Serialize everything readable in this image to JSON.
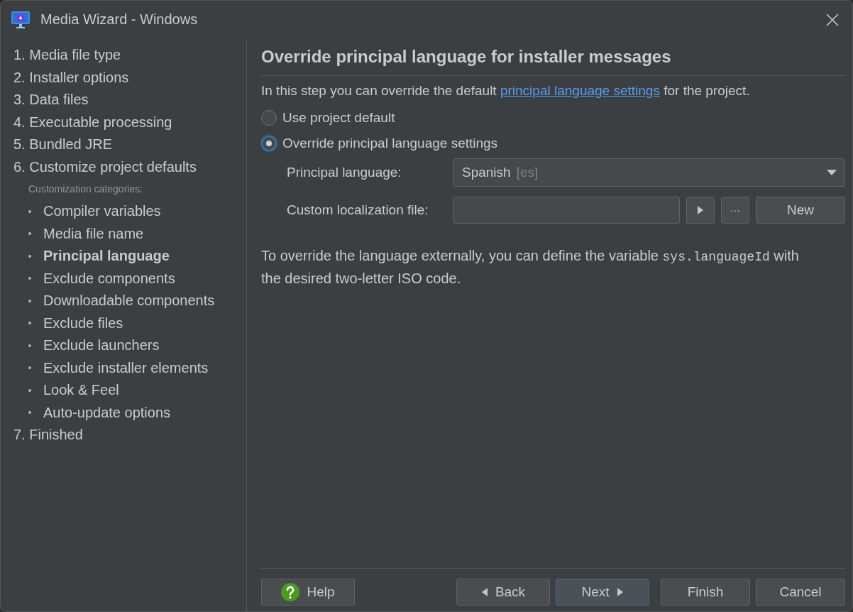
{
  "window": {
    "title": "Media Wizard - Windows"
  },
  "sidebar": {
    "steps": [
      {
        "label": "1. Media file type",
        "selected": false
      },
      {
        "label": "2. Installer options",
        "selected": false
      },
      {
        "label": "3. Data files",
        "selected": false
      },
      {
        "label": "4. Executable processing",
        "selected": false
      },
      {
        "label": "5. Bundled JRE",
        "selected": false
      },
      {
        "label": "6. Customize project defaults",
        "selected": false,
        "caption": "Customization categories:",
        "children": [
          {
            "label": "Compiler variables",
            "selected": false
          },
          {
            "label": "Media file name",
            "selected": false
          },
          {
            "label": "Principal language",
            "selected": true
          },
          {
            "label": "Exclude components",
            "selected": false
          },
          {
            "label": "Downloadable components",
            "selected": false
          },
          {
            "label": "Exclude files",
            "selected": false
          },
          {
            "label": "Exclude launchers",
            "selected": false
          },
          {
            "label": "Exclude installer elements",
            "selected": false
          },
          {
            "label": "Look & Feel",
            "selected": false
          },
          {
            "label": "Auto-update options",
            "selected": false
          }
        ]
      },
      {
        "label": "7. Finished",
        "selected": false
      }
    ]
  },
  "content": {
    "heading": "Override principal language for installer messages",
    "intro": {
      "before": "In this step you can override the default ",
      "link": "principal language settings",
      "after": " for the project."
    },
    "options": [
      {
        "label": "Use project default",
        "selected": false
      },
      {
        "label": "Override principal language settings",
        "selected": true
      }
    ],
    "principal_language": {
      "label": "Principal language:",
      "value": "Spanish",
      "code": "[es]"
    },
    "localization_file": {
      "label": "Custom localization file:",
      "buttons": [
        {
          "kind": "play"
        },
        {
          "kind": "ellipsis",
          "label": "···"
        },
        {
          "kind": "text",
          "label": "New"
        }
      ]
    },
    "note": {
      "before": "To override the language externally, you can define the variable ",
      "code": "sys.languageId",
      "after": " with the desired two-letter ISO code."
    }
  },
  "footer": {
    "buttons": [
      {
        "label": "Help",
        "kind": "help",
        "focused": false
      },
      {
        "label": "Back",
        "kind": "back",
        "focused": false
      },
      {
        "label": "Next",
        "kind": "next",
        "focused": true
      },
      {
        "label": "Finish",
        "kind": "plain",
        "focused": false
      },
      {
        "label": "Cancel",
        "kind": "plain",
        "focused": false
      }
    ]
  }
}
